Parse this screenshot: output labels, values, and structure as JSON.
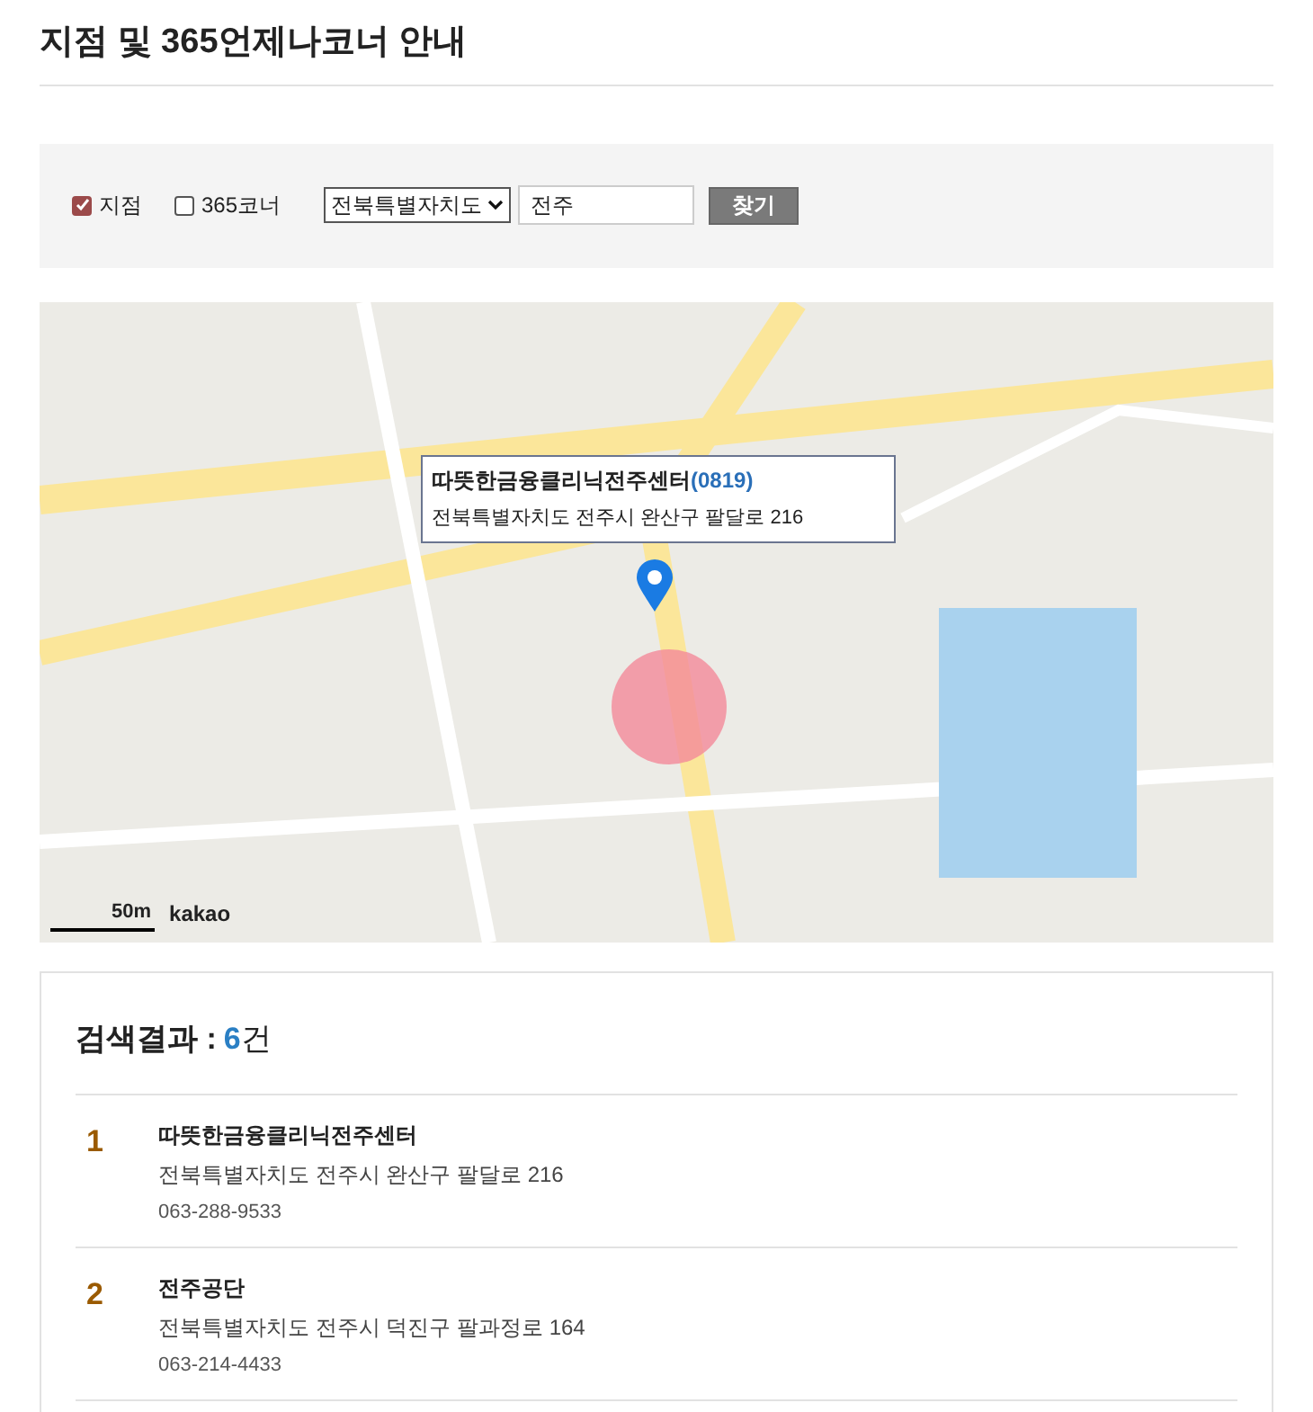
{
  "title": "지점 및 365언제나코너 안내",
  "filters": [
    {
      "label": "지점",
      "checked": true
    },
    {
      "label": "365코너",
      "checked": false
    }
  ],
  "region_select": {
    "value": "전북특별자치도"
  },
  "search": {
    "value": "전주"
  },
  "search_button": "찾기",
  "map": {
    "popup": {
      "name": "따뜻한금융클리닉전주센터",
      "code": "(0819)",
      "address": "전북특별자치도 전주시 완산구 팔달로 216"
    },
    "scale": "50m",
    "logo": "kakao"
  },
  "results": {
    "label": "검색결과 :",
    "count": "6",
    "unit": "건",
    "items": [
      {
        "number": "1",
        "name": "따뜻한금융클리닉전주센터",
        "address": "전북특별자치도 전주시 완산구 팔달로 216",
        "phone": "063-288-9533"
      },
      {
        "number": "2",
        "name": "전주공단",
        "address": "전북특별자치도 전주시 덕진구 팔과정로 164",
        "phone": "063-214-4433"
      }
    ]
  }
}
